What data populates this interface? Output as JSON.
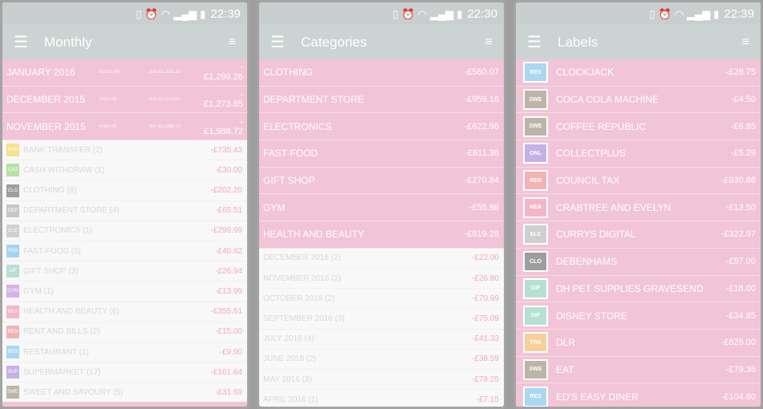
{
  "status": {
    "time": "22:39",
    "time2": "22:30",
    "time3": "22:39"
  },
  "monthly": {
    "title": "Monthly",
    "months": [
      {
        "name": "JANUARY 2016",
        "in": "in:£25.99",
        "out": "out:-£1,325.25",
        "amount": "-£1,299.26"
      },
      {
        "name": "DECEMBER 2015",
        "in": "in:£0.00",
        "out": "out:-£1,273.65",
        "amount": "-£1,273.65"
      },
      {
        "name": "NOVEMBER 2015",
        "in": "in:£0.00",
        "out": "out:-£1,988.72",
        "amount": "-£1,988.72"
      }
    ],
    "categories": [
      {
        "abbr": "BAN",
        "color": "#f7e08a",
        "name": "BANK TRANSFER (2)",
        "amount": "-£735.43"
      },
      {
        "abbr": "CAS",
        "color": "#b9e0a5",
        "name": "CASH WITHDRAW (1)",
        "amount": "-£30.00"
      },
      {
        "abbr": "CLO",
        "color": "#9e9e9e",
        "name": "CLOTHING (8)",
        "amount": "-£202.20"
      },
      {
        "abbr": "DEP",
        "color": "#c6c6c6",
        "name": "DEPARTMENT STORE (4)",
        "amount": "-£65.51"
      },
      {
        "abbr": "ELE",
        "color": "#cfcfcf",
        "name": "ELECTRONICS (1)",
        "amount": "-£299.99"
      },
      {
        "abbr": "FAS",
        "color": "#a7d3f2",
        "name": "FAST-FOOD (3)",
        "amount": "-£40.82"
      },
      {
        "abbr": "GIF",
        "color": "#b6e0d2",
        "name": "GIFT SHOP (3)",
        "amount": "-£26.94"
      },
      {
        "abbr": "GYM",
        "color": "#d4b3e8",
        "name": "GYM (1)",
        "amount": "-£13.99"
      },
      {
        "abbr": "HEA",
        "color": "#f5b5c8",
        "name": "HEALTH AND BEAUTY (6)",
        "amount": "-£355.61"
      },
      {
        "abbr": "REN",
        "color": "#f3b3b3",
        "name": "RENT AND BILLS (2)",
        "amount": "-£15.00"
      },
      {
        "abbr": "RES",
        "color": "#a9d8f0",
        "name": "RESTAURANT (1)",
        "amount": "-£9.90"
      },
      {
        "abbr": "SUP",
        "color": "#c4b2e6",
        "name": "SUPERMARKET (17)",
        "amount": "-£161.64"
      },
      {
        "abbr": "SWE",
        "color": "#bdb5a8",
        "name": "SWEET AND SAVOURY (5)",
        "amount": "-£31.69"
      }
    ]
  },
  "categories_screen": {
    "title": "Categories",
    "items": [
      {
        "name": "CLOTHING",
        "amount": "-£560.07"
      },
      {
        "name": "DEPARTMENT STORE",
        "amount": "-£959.16"
      },
      {
        "name": "ELECTRONICS",
        "amount": "-£622.96"
      },
      {
        "name": "FAST-FOOD",
        "amount": "-£611.36"
      },
      {
        "name": "GIFT SHOP",
        "amount": "-£270.84"
      },
      {
        "name": "GYM",
        "amount": "-£55.96"
      },
      {
        "name": "HEALTH AND BEAUTY",
        "amount": "-£819.28"
      }
    ],
    "months": [
      {
        "name": "DECEMBER 2016 (2)",
        "amount": "-£22.00"
      },
      {
        "name": "NOVEMBER 2016 (2)",
        "amount": "-£26.80"
      },
      {
        "name": "OCTOBER 2016 (2)",
        "amount": "-£70.99"
      },
      {
        "name": "SEPTEMBER 2016 (3)",
        "amount": "-£75.09"
      },
      {
        "name": "JULY 2016 (4)",
        "amount": "-£41.33"
      },
      {
        "name": "JUNE 2016 (2)",
        "amount": "-£38.59"
      },
      {
        "name": "MAY 2016 (3)",
        "amount": "-£78.25"
      },
      {
        "name": "APRIL 2016 (1)",
        "amount": "-£7.15"
      }
    ]
  },
  "labels_screen": {
    "title": "Labels",
    "items": [
      {
        "abbr": "RES",
        "color": "#a9d8f0",
        "name": "CLOCKJACK",
        "amount": "-£28.75"
      },
      {
        "abbr": "SWE",
        "color": "#bdb5a8",
        "name": "COCA COLA MACHINE",
        "amount": "-£4.50"
      },
      {
        "abbr": "SWE",
        "color": "#bdb5a8",
        "name": "COFFEE REPUBLIC",
        "amount": "-£6.85"
      },
      {
        "abbr": "ONL",
        "color": "#c4b2e6",
        "name": "COLLECTPLUS",
        "amount": "-£5.29"
      },
      {
        "abbr": "REN",
        "color": "#f3b3b3",
        "name": "COUNCIL TAX",
        "amount": "-£930.88"
      },
      {
        "abbr": "HEA",
        "color": "#f5b5c8",
        "name": "CRABTREE AND EVELYN",
        "amount": "-£13.50"
      },
      {
        "abbr": "ELE",
        "color": "#cfcfcf",
        "name": "CURRYS DIGITAL",
        "amount": "-£322.97"
      },
      {
        "abbr": "CLO",
        "color": "#9e9e9e",
        "name": "DEBENHAMS",
        "amount": "-£57.00"
      },
      {
        "abbr": "GIF",
        "color": "#b6e0d2",
        "name": "DH PET SUPPLIES GRAVESEND",
        "amount": "-£18.00"
      },
      {
        "abbr": "GIF",
        "color": "#b6e0d2",
        "name": "DISNEY STORE",
        "amount": "-£34.85"
      },
      {
        "abbr": "TRA",
        "color": "#f7cf9a",
        "name": "DLR",
        "amount": "-£825.00"
      },
      {
        "abbr": "SWE",
        "color": "#bdb5a8",
        "name": "EAT",
        "amount": "-£79.36"
      },
      {
        "abbr": "RES",
        "color": "#a9d8f0",
        "name": "ED'S EASY DINER",
        "amount": "-£104.60"
      }
    ]
  }
}
